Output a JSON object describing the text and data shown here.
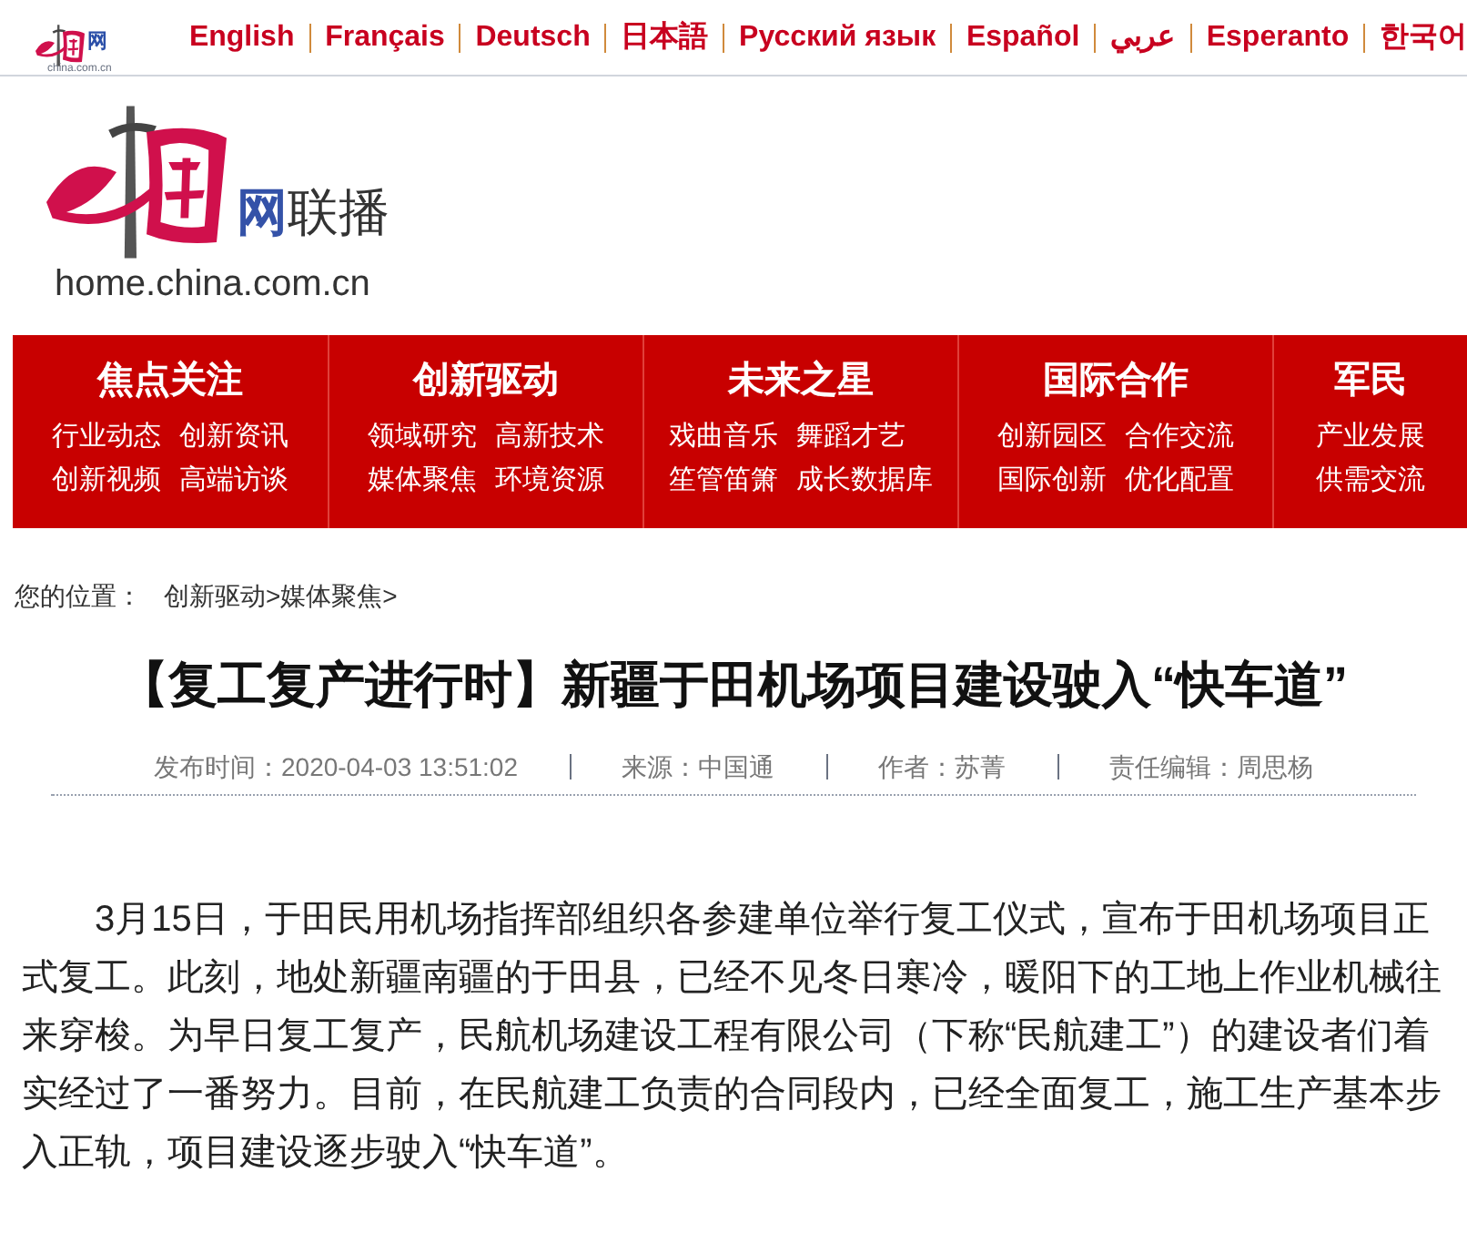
{
  "top_bar": {
    "logo": {
      "mark": "网",
      "domain": "china.com.cn"
    },
    "languages": [
      {
        "label": "English"
      },
      {
        "label": "Français"
      },
      {
        "label": "Deutsch"
      },
      {
        "label": "日本語"
      },
      {
        "label": "Русский язык"
      },
      {
        "label": "Español"
      },
      {
        "label": "عربي"
      },
      {
        "label": "Esperanto"
      },
      {
        "label": "한국어"
      }
    ]
  },
  "header": {
    "logo": {
      "mark": "网",
      "name": "联播",
      "domain": "home.china.com.cn"
    }
  },
  "nav": [
    {
      "title": "焦点关注",
      "links": [
        "行业动态",
        "创新资讯",
        "创新视频",
        "高端访谈"
      ]
    },
    {
      "title": "创新驱动",
      "links": [
        "领域研究",
        "高新技术",
        "媒体聚焦",
        "环境资源"
      ]
    },
    {
      "title": "未来之星",
      "links": [
        "戏曲音乐",
        "舞蹈才艺",
        "笙管笛箫",
        "成长数据库"
      ]
    },
    {
      "title": "国际合作",
      "links": [
        "创新园区",
        "合作交流",
        "国际创新",
        "优化配置"
      ]
    },
    {
      "title": "军民",
      "links": [
        "产业发展",
        "供需交流"
      ]
    }
  ],
  "breadcrumb": {
    "label": "您的位置：",
    "path": "创新驱动>媒体聚焦>"
  },
  "article": {
    "title": "【复工复产进行时】新疆于田机场项目建设驶入“快车道”",
    "meta": [
      "发布时间：2020-04-03 13:51:02",
      "来源：中国通",
      "作者：苏菁",
      "责任编辑：周思杨"
    ],
    "paragraph": "3月15日，于田民用机场指挥部组织各参建单位举行复工仪式，宣布于田机场项目正式复工。此刻，地处新疆南疆的于田县，已经不见冬日寒冷，暖阳下的工地上作业机械往来穿梭。为早日复工复产，民航机场建设工程有限公司（下称“民航建工”）的建设者们着实经过了一番努力。目前，在民航建工负责的合同段内，已经全面复工，施工生产基本步入正轨，项目建设逐步驶入“快车道”。"
  }
}
